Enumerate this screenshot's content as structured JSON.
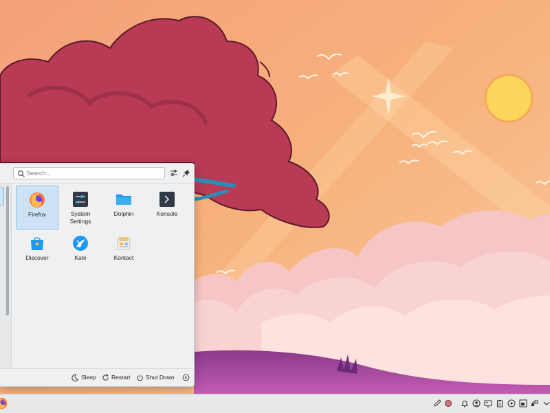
{
  "search": {
    "placeholder": "Search..."
  },
  "apps": [
    {
      "label": "Firefox",
      "icon": "firefox-icon",
      "selected": true
    },
    {
      "label": "System\nSettings",
      "icon": "system-settings-icon",
      "selected": false
    },
    {
      "label": "Dolphin",
      "icon": "dolphin-folder-icon",
      "selected": false
    },
    {
      "label": "Konsole",
      "icon": "konsole-terminal-icon",
      "selected": false
    },
    {
      "label": "Discover",
      "icon": "discover-store-icon",
      "selected": false
    },
    {
      "label": "Kate",
      "icon": "kate-editor-icon",
      "selected": false
    },
    {
      "label": "Kontact",
      "icon": "kontact-icon",
      "selected": false
    }
  ],
  "footer": {
    "sleep": "Sleep",
    "restart": "Restart",
    "shutdown": "Shut Down"
  },
  "colors": {
    "accent": "#3daee9",
    "selection": "#cde3f5",
    "panel": "#eff0f1",
    "taskbar": "#e7e9eb"
  }
}
